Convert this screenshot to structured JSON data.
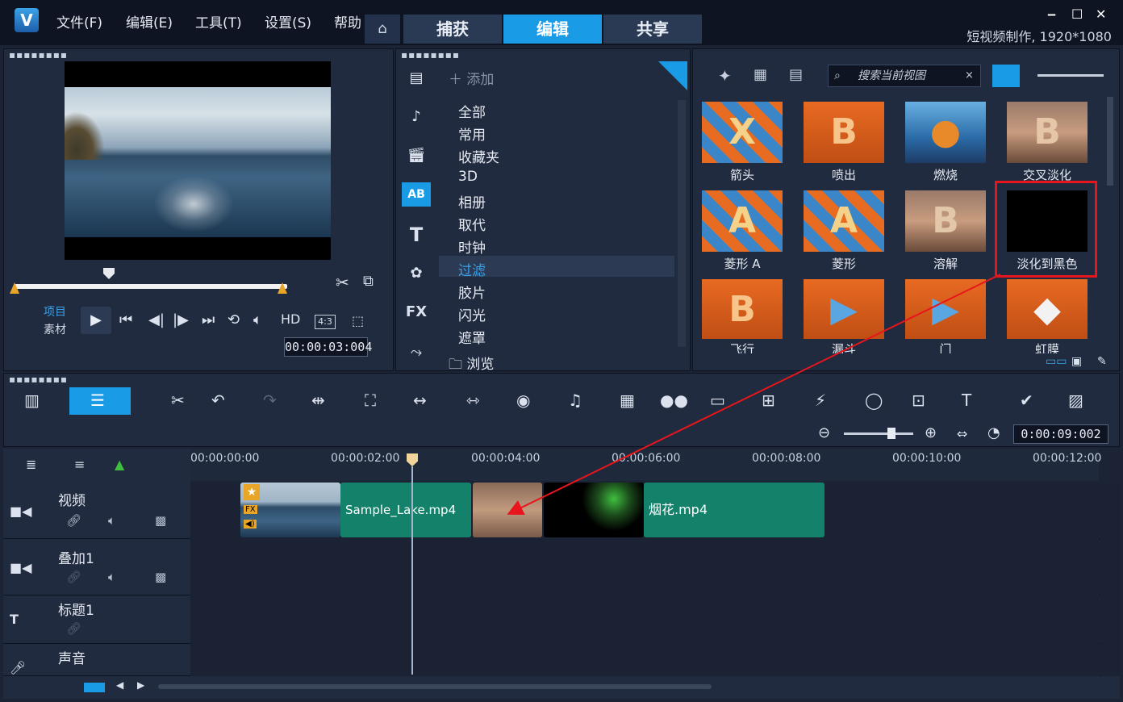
{
  "app": {
    "logo_letter": "V",
    "menu": [
      "文件(F)",
      "编辑(E)",
      "工具(T)",
      "设置(S)",
      "帮助"
    ],
    "tabs": [
      "捕获",
      "编辑",
      "共享"
    ],
    "active_tab": "编辑",
    "project_info": "短视频制作, 1920*1080"
  },
  "preview": {
    "mode_project": "项目",
    "mode_clip": "素材",
    "hd_label": "HD",
    "aspect_label": "4:3",
    "timecode": "00:00:03:004"
  },
  "library": {
    "add_label": "添加",
    "categories": [
      "全部",
      "常用",
      "收藏夹",
      "3D",
      "相册",
      "取代",
      "时钟",
      "过滤",
      "胶片",
      "闪光",
      "遮罩"
    ],
    "selected_category": "过滤",
    "browse_label": "浏览",
    "sidebar_icons": [
      "media-icon",
      "audio-icon",
      "instant-project-icon",
      "transition-icon",
      "title-icon",
      "graphics-icon",
      "fx-icon",
      "path-icon"
    ],
    "fx_label": "FX",
    "ab_label": "AB",
    "t_label": "T"
  },
  "search": {
    "placeholder": "搜索当前视图"
  },
  "transitions": [
    {
      "label": "箭头"
    },
    {
      "label": "喷出"
    },
    {
      "label": "燃烧"
    },
    {
      "label": "交叉淡化"
    },
    {
      "label": "菱形 A"
    },
    {
      "label": "菱形"
    },
    {
      "label": "溶解"
    },
    {
      "label": "淡化到黑色"
    },
    {
      "label": "飞行"
    },
    {
      "label": "漏斗"
    },
    {
      "label": "门"
    },
    {
      "label": "虹膜"
    }
  ],
  "highlighted_transition": "淡化到黑色",
  "timeline": {
    "timecode": "0:00:09:002",
    "ruler_ticks": [
      "00:00:00:00",
      "00:00:02:00",
      "00:00:04:00",
      "00:00:06:00",
      "00:00:08:00",
      "00:00:10:00",
      "00:00:12:00"
    ],
    "tracks": [
      {
        "name": "视频"
      },
      {
        "name": "叠加1"
      },
      {
        "name": "标题1"
      },
      {
        "name": "声音"
      }
    ],
    "clips": {
      "lake": "Sample_Lake.mp4",
      "fireworks": "烟花.mp4"
    },
    "fx_badge": "FX",
    "title_track_icon": "T"
  },
  "colors": {
    "accent": "#1a9be6",
    "highlight_box": "#e8151c",
    "clip_green": "#14826a"
  }
}
